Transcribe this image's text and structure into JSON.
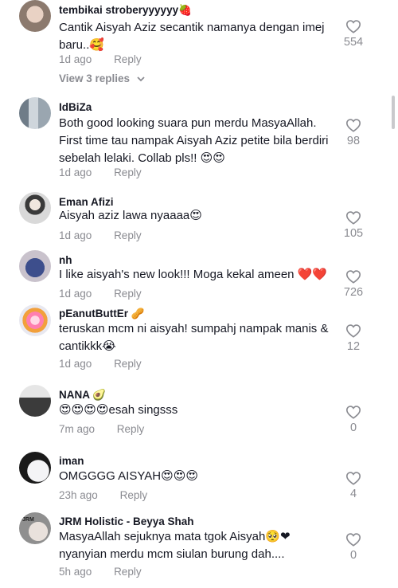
{
  "comments": [
    {
      "username": "tembikai stroberyyyyyy🍓",
      "lines": [
        "Cantik Aisyah Aziz secantik namanya dengan imej",
        "baru..🥰"
      ],
      "time": "1d ago",
      "reply": "Reply",
      "likes": "554",
      "view_replies": "View 3 replies"
    },
    {
      "username": "IdBiZa",
      "lines": [
        "Both good looking suara pun merdu MasyaAllah.",
        "First time tau nampak Aisyah Aziz petite bila berdiri",
        "sebelah lelaki. Collab pls!! 😍😍"
      ],
      "time": "1d ago",
      "reply": "Reply",
      "likes": "98"
    },
    {
      "username": "Eman Afizi",
      "lines": [
        "Aisyah aziz lawa nyaaaa😍"
      ],
      "time": "1d ago",
      "reply": "Reply",
      "likes": "105"
    },
    {
      "username": "nh",
      "lines": [
        "I like aisyah's new look!!! Moga kekal ameen ❤️❤️"
      ],
      "time": "1d ago",
      "reply": "Reply",
      "likes": "726"
    },
    {
      "username": "pEanutButtEr 🥜",
      "lines": [
        "teruskan mcm ni aisyah! sumpahj nampak manis &",
        "cantikkk😭"
      ],
      "time": "1d ago",
      "reply": "Reply",
      "likes": "12"
    },
    {
      "username": "NANA 🥑",
      "lines": [
        "😍😍😍😍esah singsss"
      ],
      "time": "7m ago",
      "reply": "Reply",
      "likes": "0"
    },
    {
      "username": "iman",
      "lines": [
        "OMGGGG AISYAH😍😍😍"
      ],
      "time": "23h ago",
      "reply": "Reply",
      "likes": "4"
    },
    {
      "username": "JRM Holistic - Beyya Shah",
      "lines": [
        "MasyaAllah sejuknya mata tgok Aisyah🥺❤",
        "nyanyian merdu mcm siulan burung dah...."
      ],
      "time": "5h ago",
      "reply": "Reply",
      "likes": "0"
    }
  ],
  "avatar_badges": {
    "jrm": "JRM"
  }
}
